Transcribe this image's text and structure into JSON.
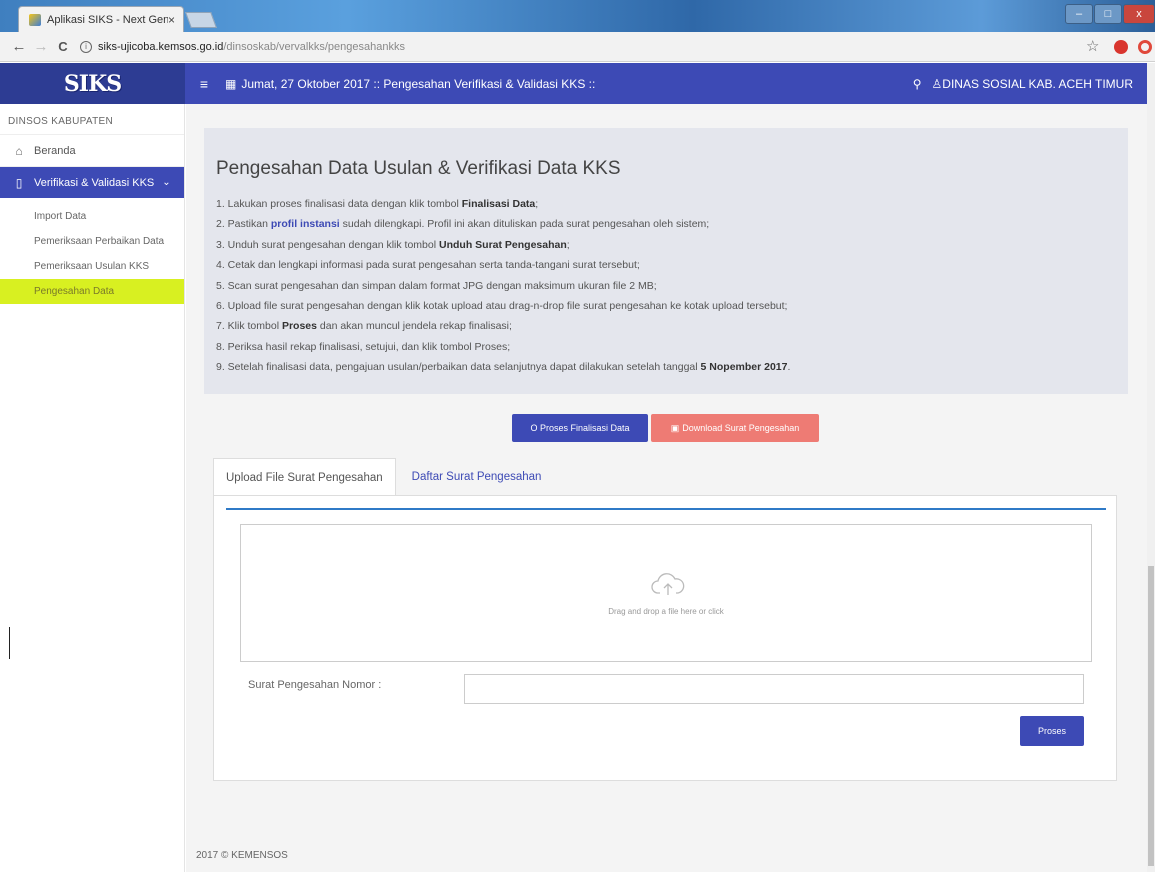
{
  "browser": {
    "tab_title": "Aplikasi SIKS - Next Gen",
    "tab_close": "×",
    "url_host": "siks-ujicoba.kemsos.go.id",
    "url_path": "/dinsoskab/vervalkks/pengesahankks",
    "info_glyph": "i",
    "back_glyph": "←",
    "forward_glyph": "→",
    "reload_glyph": "C",
    "star_glyph": "☆",
    "win_min": "–",
    "win_max": "□",
    "win_close": "x"
  },
  "app": {
    "logo_text": "SIKS",
    "menu_glyph": "≡",
    "calendar_glyph": "▦",
    "header_date": "Jumat, 27 Oktober 2017 :: Pengesahan Verifikasi & Validasi KKS ::",
    "search_glyph": "⚲",
    "user_label": "♙DINAS SOSIAL KAB. ACEH TIMUR"
  },
  "sidebar": {
    "header": "DINSOS KABUPATEN",
    "home_icon_glyph": "⌂",
    "home_label": "Beranda",
    "verif_icon_glyph": "▯",
    "verif_label": "Verifikasi & Validasi KKS",
    "verif_chevron": "⌄",
    "sub_items": [
      {
        "label": "Import Data"
      },
      {
        "label": "Pemeriksaan Perbaikan Data"
      },
      {
        "label": "Pemeriksaan Usulan KKS"
      },
      {
        "label": "Pengesahan Data"
      }
    ]
  },
  "info": {
    "title": "Pengesahan Data Usulan & Verifikasi Data KKS",
    "s1_a": "1. Lakukan proses finalisasi data dengan klik tombol ",
    "s1_b": "Finalisasi Data",
    "s1_c": ";",
    "s2_a": "2. Pastikan ",
    "s2_b": "profil instansi",
    "s2_c": " sudah dilengkapi. Profil ini akan dituliskan pada surat pengesahan oleh sistem;",
    "s3_a": "3. Unduh surat pengesahan dengan klik tombol ",
    "s3_b": "Unduh Surat Pengesahan",
    "s3_c": ";",
    "s4": "4. Cetak dan lengkapi informasi pada surat pengesahan serta tanda-tangani surat tersebut;",
    "s5": "5. Scan surat pengesahan dan simpan dalam format JPG dengan maksimum ukuran file 2 MB;",
    "s6": "6. Upload file surat pengesahan dengan klik kotak upload atau drag-n-drop file surat pengesahan ke kotak upload tersebut;",
    "s7_a": "7. Klik tombol ",
    "s7_b": "Proses",
    "s7_c": " dan akan muncul jendela rekap finalisasi;",
    "s8": "8. Periksa hasil rekap finalisasi, setujui, dan klik tombol Proses;",
    "s9_a": "9. Setelah finalisasi data, pengajuan usulan/perbaikan data selanjutnya dapat dilakukan setelah tanggal ",
    "s9_b": "5 Nopember 2017",
    "s9_c": "."
  },
  "actions": {
    "finalisasi": "O Proses Finalisasi Data",
    "download": "Download Surat Pengesahan",
    "download_glyph": "▣"
  },
  "tabs": {
    "upload": "Upload File Surat Pengesahan",
    "daftar": "Daftar Surat Pengesahan"
  },
  "upload": {
    "dropzone_text": "Drag and drop a file here or click",
    "nomor_label": "Surat Pengesahan Nomor :",
    "nomor_value": "",
    "proses": "Proses"
  },
  "footer": "2017 © KEMENSOS"
}
